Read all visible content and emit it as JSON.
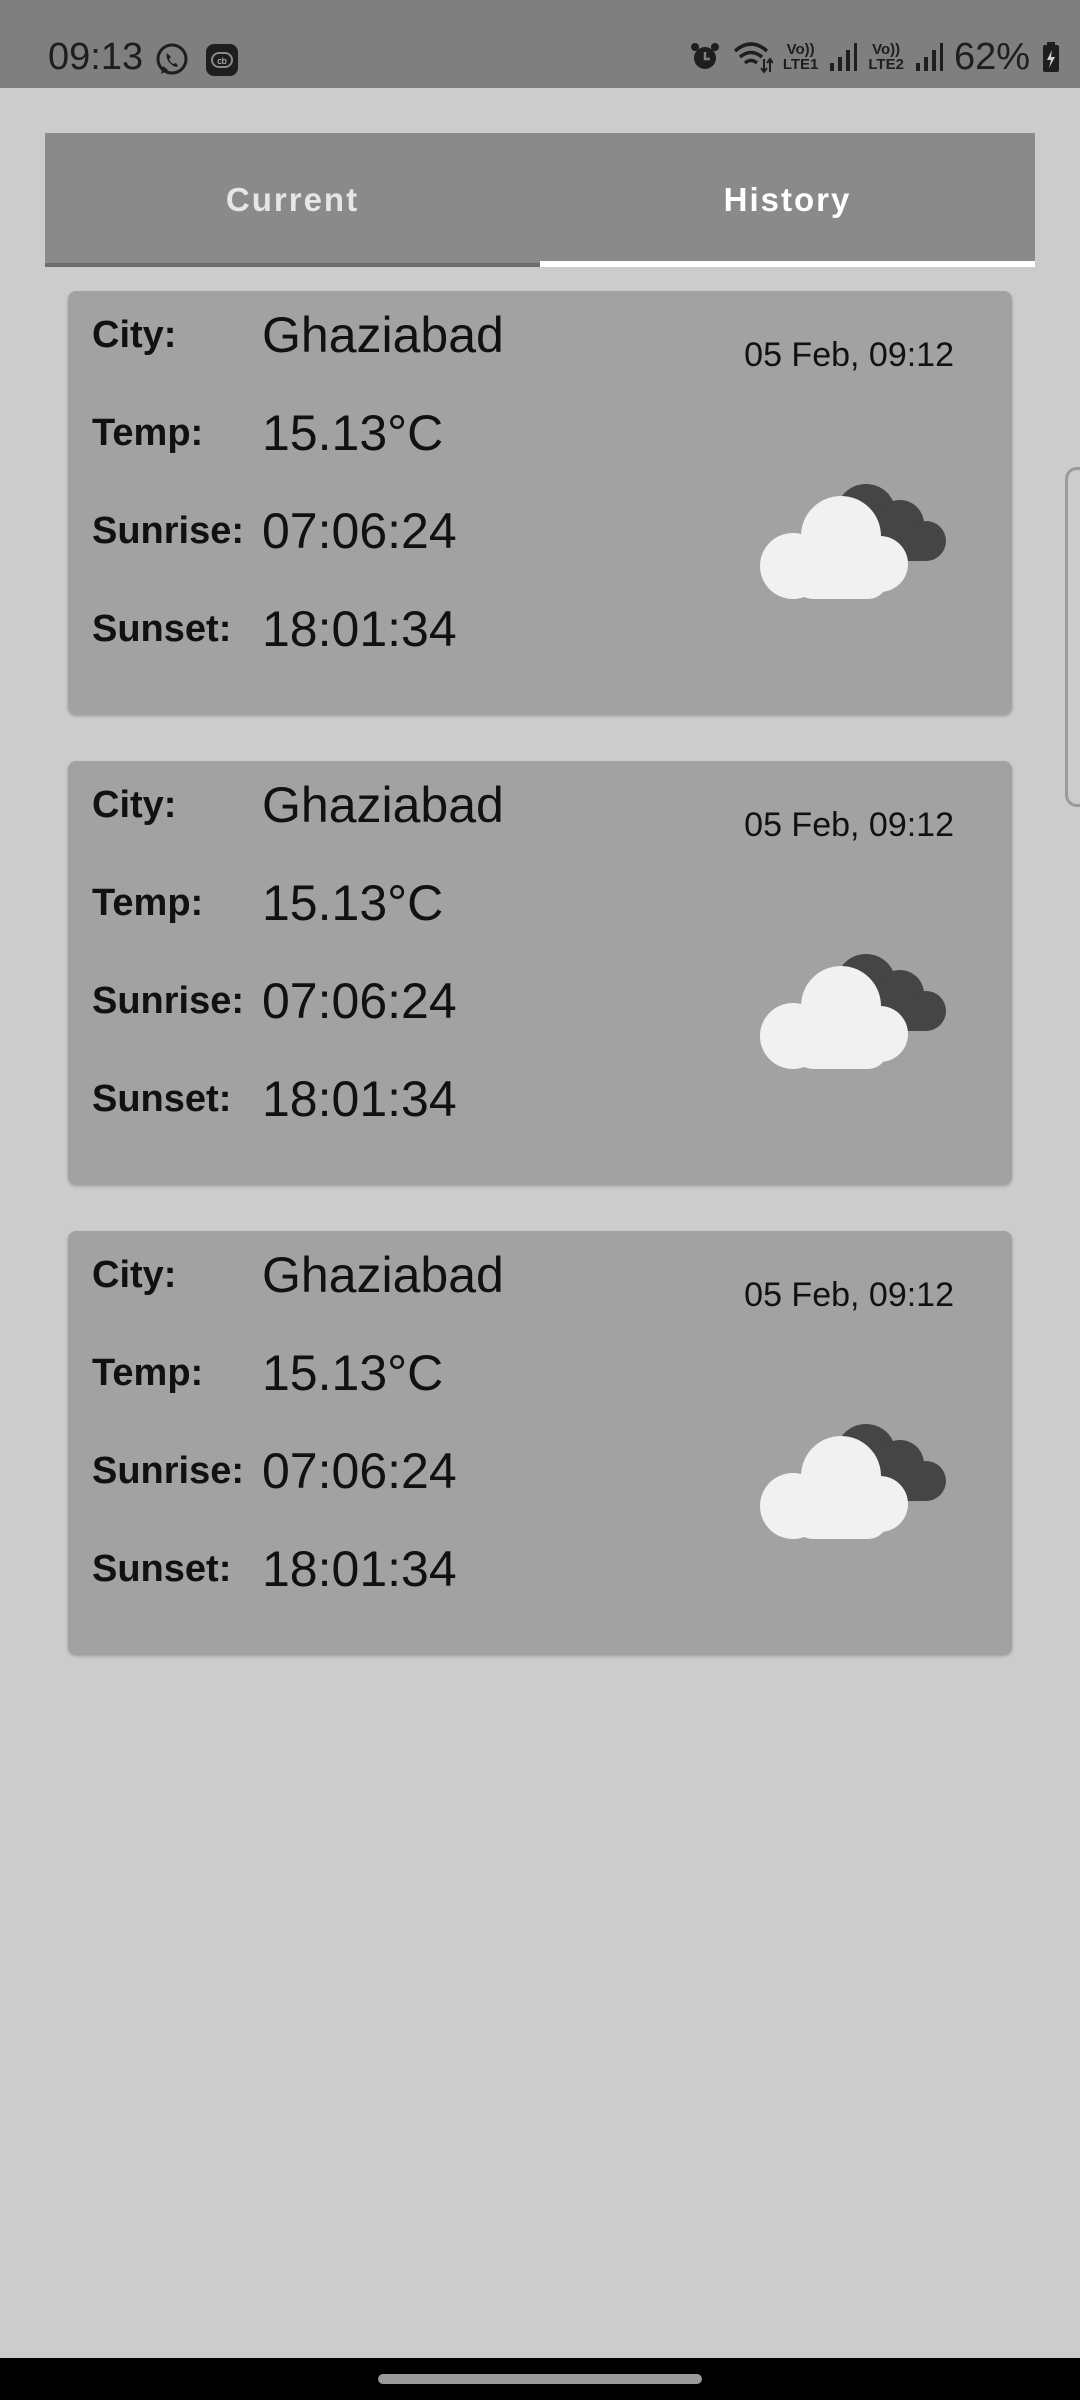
{
  "status_bar": {
    "time": "09:13",
    "battery": "62%",
    "sim1": "LTE1",
    "sim2": "LTE2",
    "volte": "Vo))",
    "icons": [
      "whatsapp-icon",
      "cb-app-icon",
      "alarm-icon",
      "wifi-icon",
      "signal-icon",
      "signal-icon",
      "battery-charging-icon"
    ]
  },
  "tabs": [
    {
      "label": "Current",
      "active": false
    },
    {
      "label": "History",
      "active": true
    }
  ],
  "labels": {
    "city": "City:",
    "temp": "Temp:",
    "sunrise": "Sunrise:",
    "sunset": "Sunset:"
  },
  "history": [
    {
      "city": "Ghaziabad",
      "temp": "15.13°C",
      "sunrise": "07:06:24",
      "sunset": "18:01:34",
      "date": "05 Feb, 09:12",
      "icon": "cloudy-icon"
    },
    {
      "city": "Ghaziabad",
      "temp": "15.13°C",
      "sunrise": "07:06:24",
      "sunset": "18:01:34",
      "date": "05 Feb, 09:12",
      "icon": "cloudy-icon"
    },
    {
      "city": "Ghaziabad",
      "temp": "15.13°C",
      "sunrise": "07:06:24",
      "sunset": "18:01:34",
      "date": "05 Feb, 09:12",
      "icon": "cloudy-icon"
    }
  ],
  "colors": {
    "background": "#cccccc",
    "tab_bar": "#8a8a8a",
    "card": "#a2a2a2",
    "indicator": "#ffffff"
  }
}
